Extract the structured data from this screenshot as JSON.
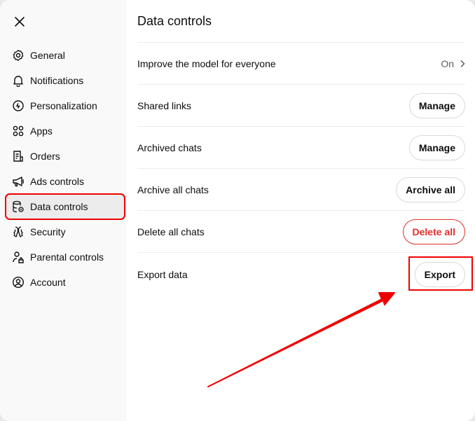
{
  "sidebar": {
    "close_icon": "close-icon",
    "items": [
      {
        "label": "General",
        "icon": "gear-icon"
      },
      {
        "label": "Notifications",
        "icon": "bell-icon"
      },
      {
        "label": "Personalization",
        "icon": "personalization-icon"
      },
      {
        "label": "Apps",
        "icon": "apps-grid-icon"
      },
      {
        "label": "Orders",
        "icon": "receipt-icon"
      },
      {
        "label": "Ads controls",
        "icon": "megaphone-icon"
      },
      {
        "label": "Data controls",
        "icon": "database-gear-icon",
        "active": true
      },
      {
        "label": "Security",
        "icon": "key-shield-icon"
      },
      {
        "label": "Parental controls",
        "icon": "person-lock-icon"
      },
      {
        "label": "Account",
        "icon": "user-circle-icon"
      }
    ]
  },
  "main": {
    "title": "Data controls",
    "rows": [
      {
        "label": "Improve the model for everyone",
        "value": "On"
      },
      {
        "label": "Shared links",
        "button": "Manage"
      },
      {
        "label": "Archived chats",
        "button": "Manage"
      },
      {
        "label": "Archive all chats",
        "button": "Archive all"
      },
      {
        "label": "Delete all chats",
        "button": "Delete all"
      },
      {
        "label": "Export data",
        "button": "Export"
      }
    ]
  },
  "colors": {
    "danger": "#e02e2a",
    "annotation": "#ee0000",
    "sidebar_bg": "#f9f9f9"
  }
}
